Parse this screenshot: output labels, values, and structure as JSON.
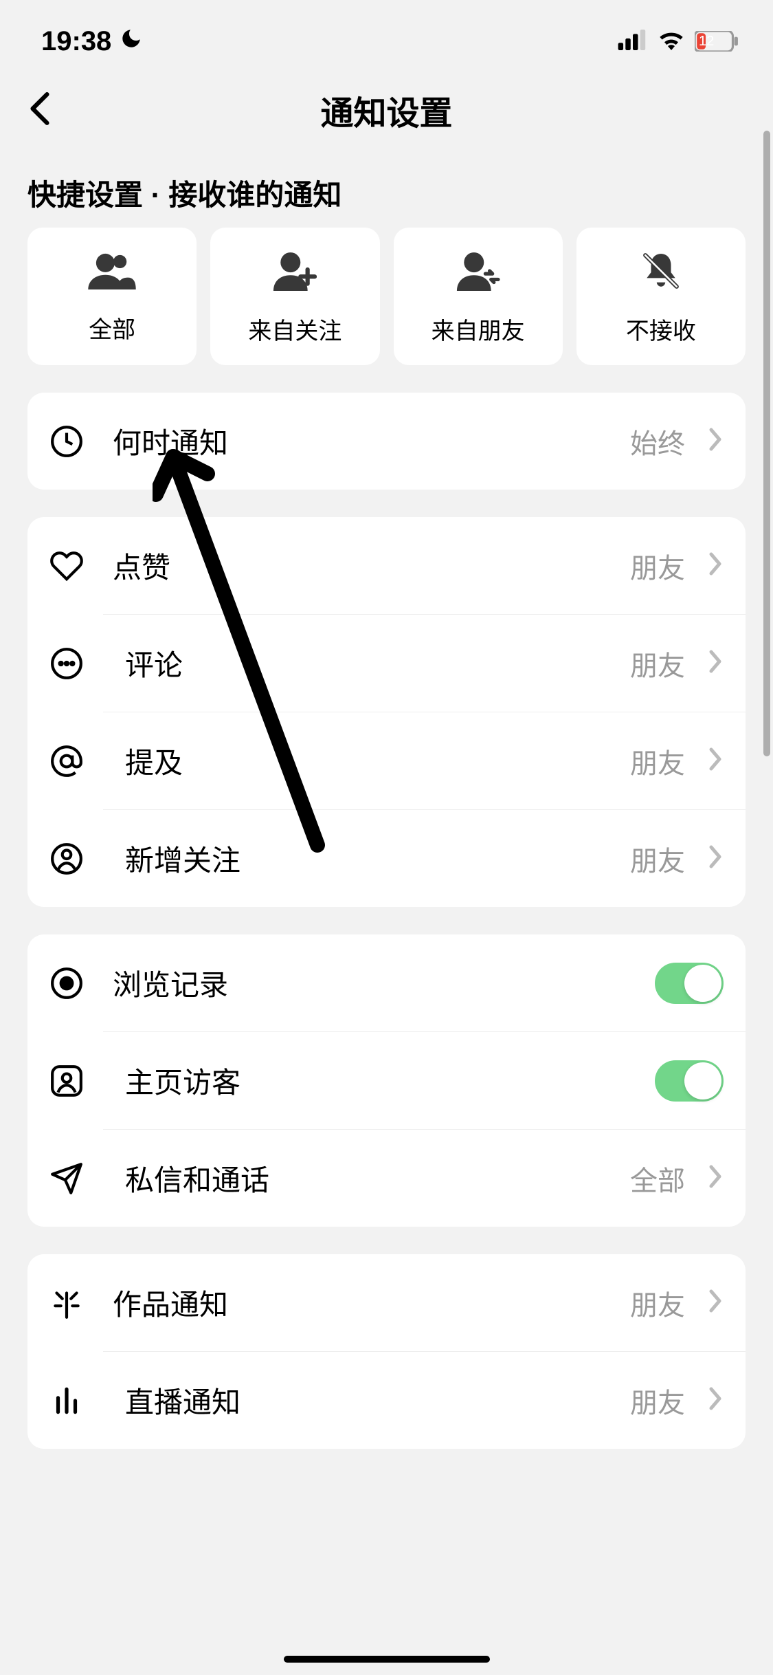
{
  "status": {
    "time": "19:38",
    "battery_percent": "12"
  },
  "header": {
    "title": "通知设置"
  },
  "quick": {
    "title": "快捷设置 · 接收谁的通知",
    "items": [
      {
        "label": "全部"
      },
      {
        "label": "来自关注"
      },
      {
        "label": "来自朋友"
      },
      {
        "label": "不接收"
      }
    ]
  },
  "groups": {
    "g1": {
      "when": {
        "label": "何时通知",
        "value": "始终"
      }
    },
    "g2": {
      "like": {
        "label": "点赞",
        "value": "朋友"
      },
      "comment": {
        "label": "评论",
        "value": "朋友"
      },
      "mention": {
        "label": "提及",
        "value": "朋友"
      },
      "newfollow": {
        "label": "新增关注",
        "value": "朋友"
      }
    },
    "g3": {
      "history": {
        "label": "浏览记录"
      },
      "visitor": {
        "label": "主页访客"
      },
      "dm": {
        "label": "私信和通话",
        "value": "全部"
      }
    },
    "g4": {
      "works": {
        "label": "作品通知",
        "value": "朋友"
      },
      "live": {
        "label": "直播通知",
        "value": "朋友"
      }
    }
  }
}
